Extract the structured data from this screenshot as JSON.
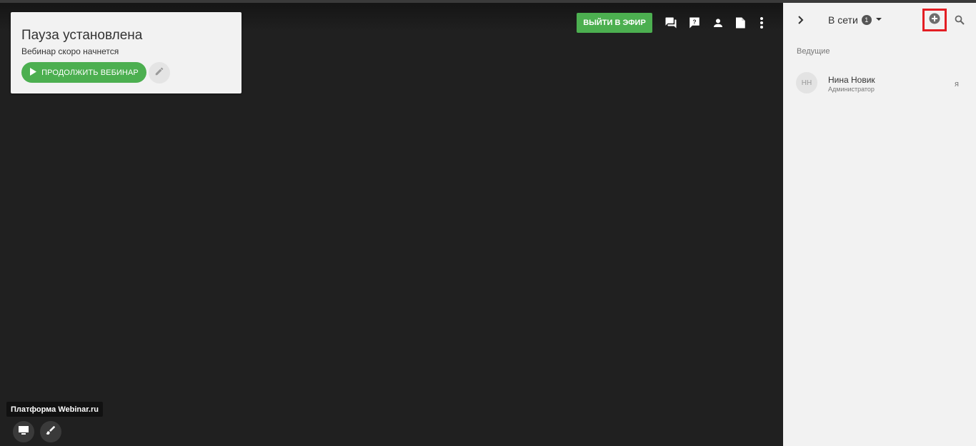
{
  "pause": {
    "title": "Пауза установлена",
    "subtitle": "Вебинар скоро начнется",
    "continue_label": "ПРОДОЛЖИТЬ ВЕБИНАР"
  },
  "toolbar": {
    "go_live_label": "ВЫЙТИ В ЭФИР",
    "icons": [
      "chat-icon",
      "question-icon",
      "person-icon",
      "document-icon",
      "more-vert-icon"
    ]
  },
  "footer": {
    "brand_tooltip": "Платформа Webinar.ru"
  },
  "panel": {
    "tab_label": "В сети",
    "online_count": "1",
    "section_label": "Ведущие",
    "users": [
      {
        "initials": "НН",
        "name": "Нина Новик",
        "role": "Администратор",
        "self_marker": "я"
      }
    ]
  },
  "colors": {
    "accent_green": "#4caf50",
    "highlight_red": "#e31e24",
    "stage_bg": "#202020",
    "panel_bg": "#f2f2f2"
  }
}
